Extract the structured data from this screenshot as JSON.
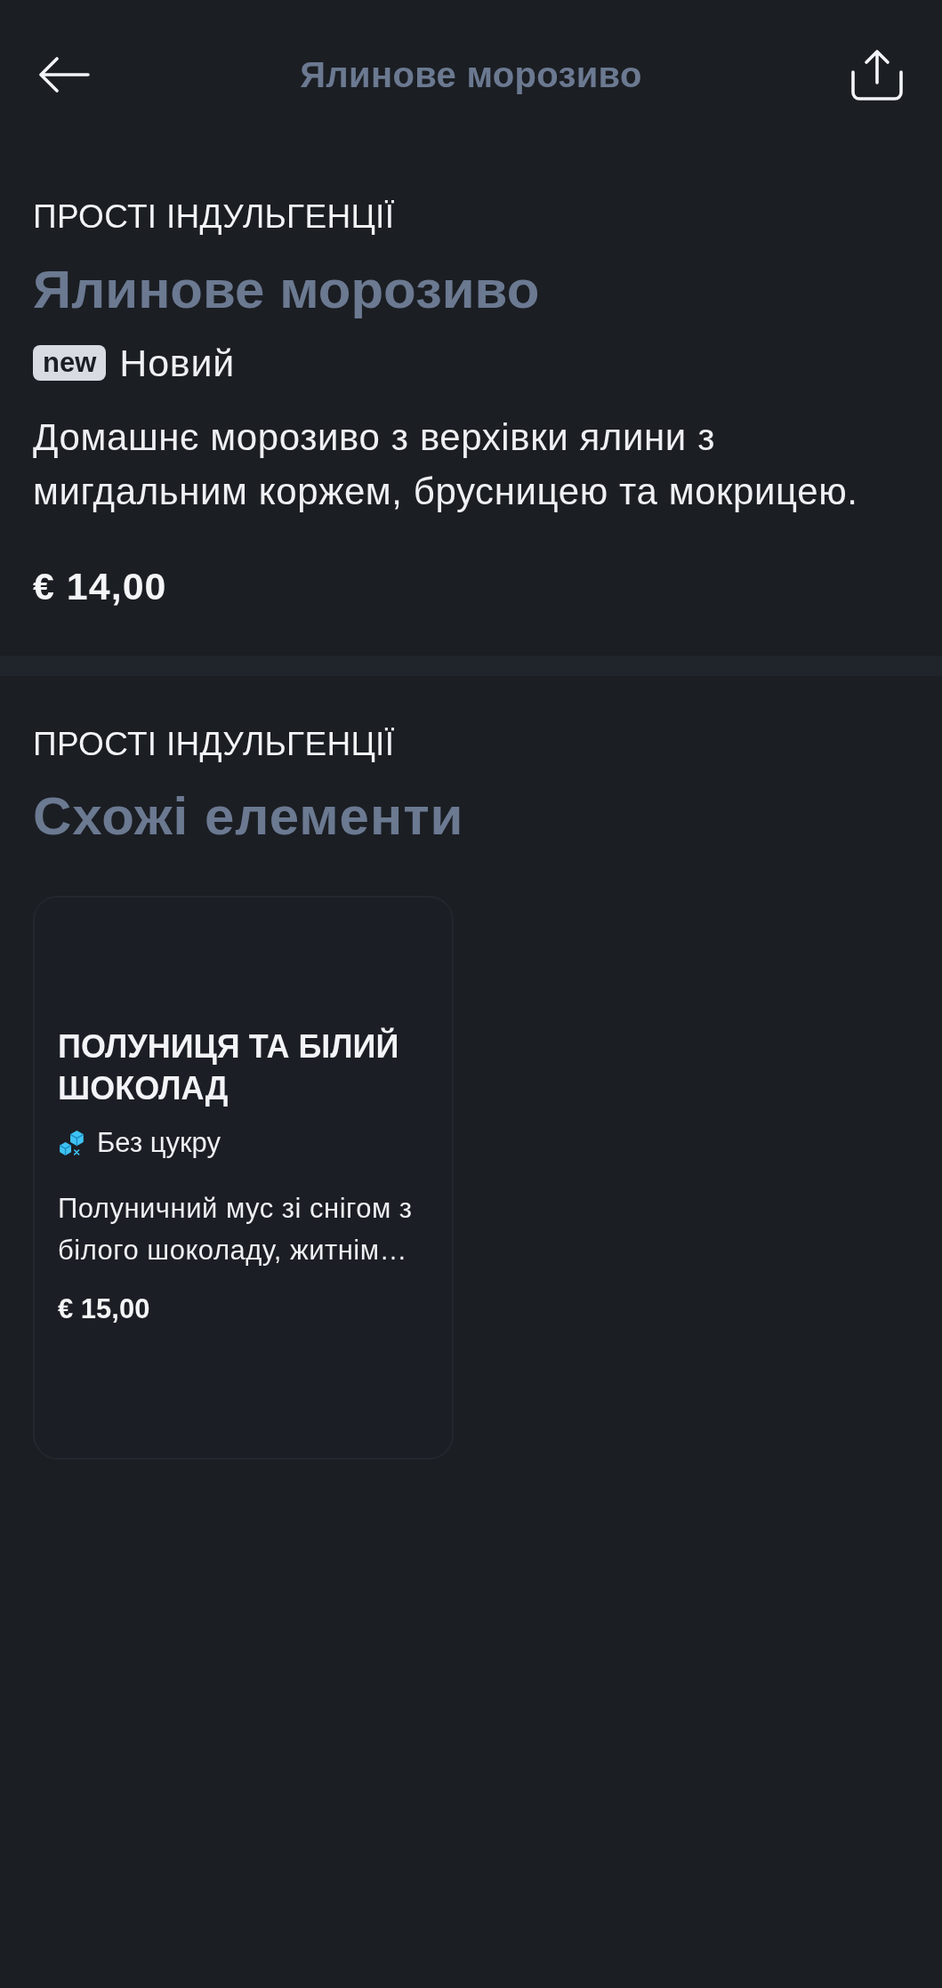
{
  "header": {
    "title": "Ялинове морозиво"
  },
  "product": {
    "category": "ПРОСТІ ІНДУЛЬГЕНЦІЇ",
    "name": "Ялинове морозиво",
    "badges": [
      {
        "kind": "new",
        "tag": "new",
        "label": "Новий"
      }
    ],
    "description": "Домашнє морозиво з верхівки ялини з мигдальним коржем, брусницею та мокрицею.",
    "price": "€ 14,00"
  },
  "related": {
    "category": "ПРОСТІ ІНДУЛЬГЕНЦІЇ",
    "title": "Схожі елементи",
    "items": [
      {
        "name": "ПОЛУНИЦЯ ТА БІЛИЙ ШОКОЛАД",
        "tags": [
          {
            "kind": "sugar-free",
            "label": "Без цукру"
          }
        ],
        "description": "Полуничний мус зі снігом з білого шоколаду, житнім…",
        "price": "€ 15,00"
      }
    ]
  }
}
